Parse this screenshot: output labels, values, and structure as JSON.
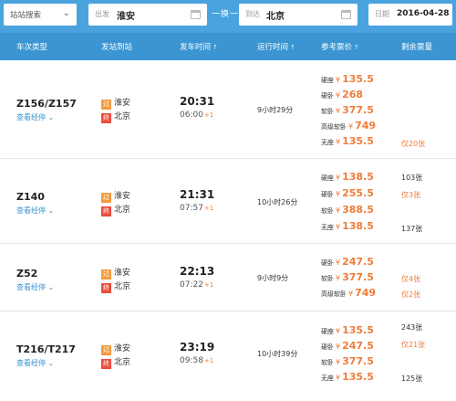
{
  "search": {
    "station_search": "站站搜索",
    "from_label": "出发",
    "from_value": "淮安",
    "swap_label": "一换一",
    "to_label": "到达",
    "to_value": "北京",
    "date_label": "日期",
    "date_value": "2016-04-28"
  },
  "header": {
    "train_type": "车次类型",
    "stations": "发站到站",
    "dep_time": "发车时间",
    "duration": "运行时间",
    "price": "参考票价",
    "remaining": "剩余票量",
    "sort_icon": "↑"
  },
  "rows": [
    {
      "train": "Z156/Z157",
      "stops": "查看经停",
      "from_tag": "过",
      "from": "淮安",
      "to_tag": "终",
      "to": "北京",
      "dep": "20:31",
      "arr": "06:00",
      "arr_plus": "+1",
      "duration": "9小时29分",
      "prices": [
        {
          "seat": "硬座",
          "yen": "¥",
          "price": "135.5"
        },
        {
          "seat": "硬卧",
          "yen": "¥",
          "price": "268"
        },
        {
          "seat": "软卧",
          "yen": "¥",
          "price": "377.5"
        },
        {
          "seat": "高级软卧",
          "yen": "¥",
          "price": "749"
        },
        {
          "seat": "无座",
          "yen": "¥",
          "price": "135.5"
        }
      ],
      "remaining": [
        "",
        "",
        "",
        "",
        "仅20张"
      ]
    },
    {
      "train": "Z140",
      "stops": "查看经停",
      "from_tag": "过",
      "from": "淮安",
      "to_tag": "终",
      "to": "北京",
      "dep": "21:31",
      "arr": "07:57",
      "arr_plus": "+1",
      "duration": "10小时26分",
      "prices": [
        {
          "seat": "硬座",
          "yen": "¥",
          "price": "138.5"
        },
        {
          "seat": "硬卧",
          "yen": "¥",
          "price": "255.5"
        },
        {
          "seat": "软卧",
          "yen": "¥",
          "price": "388.5"
        },
        {
          "seat": "无座",
          "yen": "¥",
          "price": "138.5"
        }
      ],
      "remaining": [
        "103张",
        "仅3张",
        "",
        "137张"
      ]
    },
    {
      "train": "Z52",
      "stops": "查看经停",
      "from_tag": "过",
      "from": "淮安",
      "to_tag": "终",
      "to": "北京",
      "dep": "22:13",
      "arr": "07:22",
      "arr_plus": "+1",
      "duration": "9小时9分",
      "prices": [
        {
          "seat": "硬卧",
          "yen": "¥",
          "price": "247.5"
        },
        {
          "seat": "软卧",
          "yen": "¥",
          "price": "377.5"
        },
        {
          "seat": "高级软卧",
          "yen": "¥",
          "price": "749"
        }
      ],
      "remaining": [
        "",
        "仅4张",
        "仅2张"
      ]
    },
    {
      "train": "T216/T217",
      "stops": "查看经停",
      "from_tag": "过",
      "from": "淮安",
      "to_tag": "终",
      "to": "北京",
      "dep": "23:19",
      "arr": "09:58",
      "arr_plus": "+1",
      "duration": "10小时39分",
      "prices": [
        {
          "seat": "硬座",
          "yen": "¥",
          "price": "135.5"
        },
        {
          "seat": "硬卧",
          "yen": "¥",
          "price": "247.5"
        },
        {
          "seat": "软卧",
          "yen": "¥",
          "price": "377.5"
        },
        {
          "seat": "无座",
          "yen": "¥",
          "price": "135.5"
        }
      ],
      "remaining": [
        "243张",
        "仅21张",
        "",
        "125张"
      ]
    }
  ],
  "colors": {
    "header_blue": "#3a95d2",
    "search_blue": "#4aa3df",
    "price_orange": "#f07c3a",
    "pass_tag": "#f39c3d",
    "end_tag": "#e84d3d"
  },
  "icons": {
    "stops_chevron": "chevron-down-icon",
    "calendar": "calendar-icon"
  }
}
